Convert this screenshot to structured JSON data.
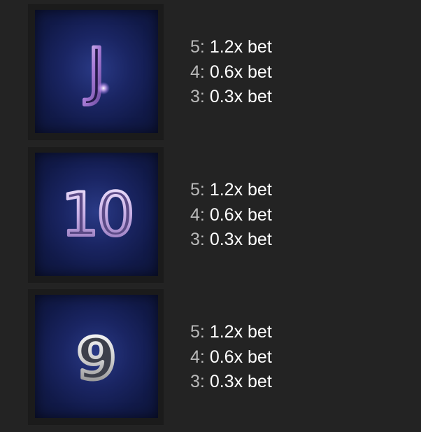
{
  "symbols": [
    {
      "symbol": "J",
      "icon": "letter-j-icon",
      "color": "#a77bd6",
      "payouts": [
        {
          "count": "5:",
          "value": "1.2x bet"
        },
        {
          "count": "4:",
          "value": "0.6x bet"
        },
        {
          "count": "3:",
          "value": "0.3x bet"
        }
      ]
    },
    {
      "symbol": "10",
      "icon": "number-10-icon",
      "color": "#d2bfe8",
      "payouts": [
        {
          "count": "5:",
          "value": "1.2x bet"
        },
        {
          "count": "4:",
          "value": "0.6x bet"
        },
        {
          "count": "3:",
          "value": "0.3x bet"
        }
      ]
    },
    {
      "symbol": "9",
      "icon": "number-9-icon",
      "color": "#dcdcdc",
      "payouts": [
        {
          "count": "5:",
          "value": "1.2x bet"
        },
        {
          "count": "4:",
          "value": "0.6x bet"
        },
        {
          "count": "3:",
          "value": "0.3x bet"
        }
      ]
    }
  ]
}
